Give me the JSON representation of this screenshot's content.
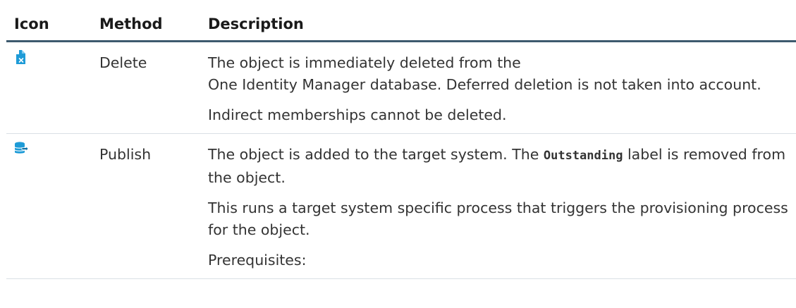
{
  "headers": {
    "icon": "Icon",
    "method": "Method",
    "description": "Description"
  },
  "rows": [
    {
      "icon": "delete-document-icon",
      "method": "Delete",
      "paragraphs": [
        {
          "line1": "The object is immediately deleted from the",
          "line2": "One Identity Manager database. Deferred deletion is not taken into account."
        },
        {
          "text": "Indirect memberships cannot be deleted."
        }
      ]
    },
    {
      "icon": "publish-database-icon",
      "method": "Publish",
      "paragraphs": [
        {
          "before": "The object is added to the target system. The ",
          "code": "Outstanding",
          "after": " label is removed from the object."
        },
        {
          "text": "This runs a target system specific process that triggers the provisioning process for the object."
        },
        {
          "text": "Prerequisites:"
        }
      ]
    }
  ],
  "colors": {
    "header_rule": "#3d5a6e",
    "row_rule": "#d9e0e5",
    "icon_accent": "#1e9bd7"
  }
}
